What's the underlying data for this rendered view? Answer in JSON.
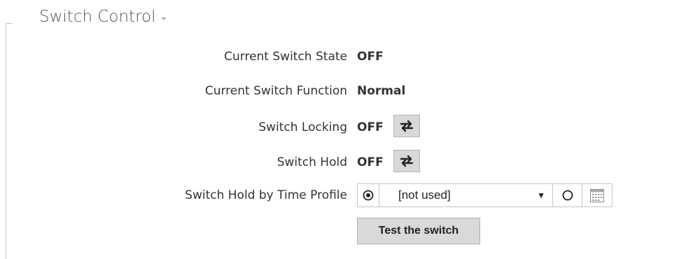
{
  "section": {
    "title": "Switch Control"
  },
  "fields": {
    "current_state": {
      "label": "Current Switch State",
      "value": "OFF"
    },
    "current_function": {
      "label": "Current Switch Function",
      "value": "Normal"
    },
    "locking": {
      "label": "Switch Locking",
      "value": "OFF",
      "button_icon": "toggle-arrows-icon"
    },
    "hold": {
      "label": "Switch Hold",
      "value": "OFF",
      "button_icon": "toggle-arrows-icon"
    },
    "time_profile": {
      "label": "Switch Hold by Time Profile",
      "selected": "[not used]",
      "calendar_icon": "calendar-icon"
    }
  },
  "actions": {
    "test_label": "Test the switch"
  }
}
